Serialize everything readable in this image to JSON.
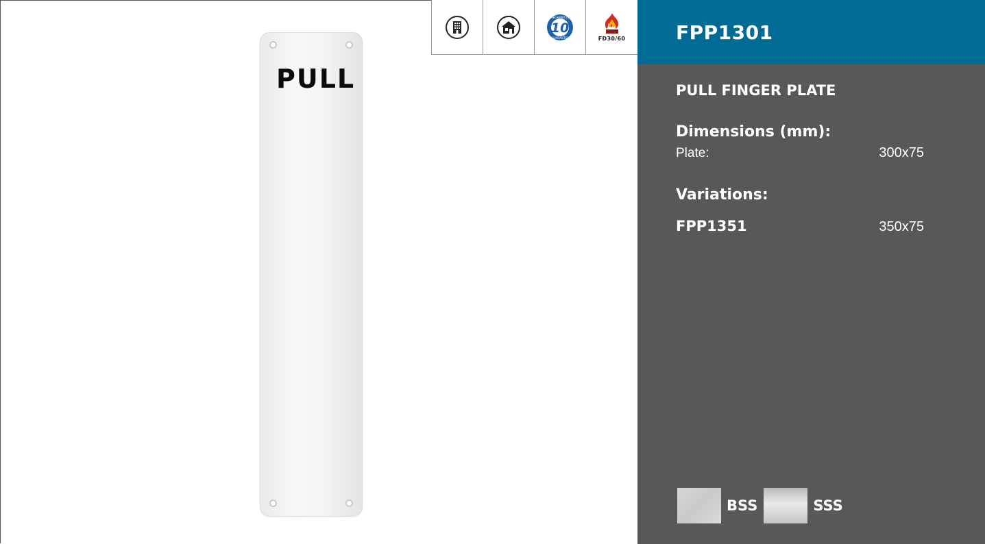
{
  "product": {
    "code": "FPP1301",
    "name": "PULL FINGER PLATE",
    "plate_text": "PULL"
  },
  "icons": [
    {
      "name": "commercial-building-icon"
    },
    {
      "name": "residential-house-icon"
    },
    {
      "name": "mechanical-guarantee-icon",
      "text": "10",
      "arc_top": "MECHANICAL",
      "arc_bottom": "GUARANTEE"
    },
    {
      "name": "fire-rated-icon",
      "label": "FD30/60"
    }
  ],
  "dimensions": {
    "heading": "Dimensions (mm):",
    "rows": [
      {
        "label": "Plate:",
        "value": "300x75"
      }
    ]
  },
  "variations": {
    "heading": "Variations:",
    "rows": [
      {
        "code": "FPP1351",
        "value": "350x75"
      }
    ]
  },
  "finishes": [
    {
      "code": "BSS"
    },
    {
      "code": "SSS"
    }
  ],
  "colors": {
    "header_blue": "#006b94",
    "panel_grey": "#58585a",
    "guarantee_blue": "#1f5fa8",
    "fire_red": "#d62a1e",
    "fire_yellow": "#f6b300"
  }
}
